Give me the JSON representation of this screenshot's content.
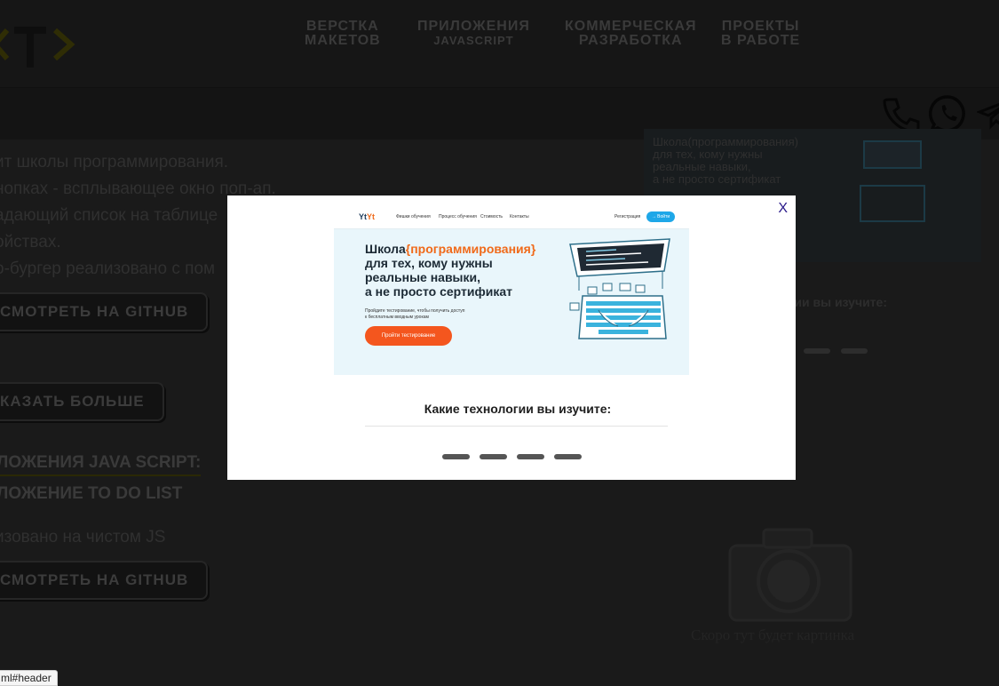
{
  "header": {
    "logo": "<T>",
    "nav": [
      {
        "line1": "ВЕРСТКА",
        "line2": "МАКЕТОВ"
      },
      {
        "line1": "ПРИЛОЖЕНИЯ",
        "line2": "JAVASCRIPT"
      },
      {
        "line1": "КОММЕРЧЕСКАЯ",
        "line2": "РАЗРАБОТКА"
      },
      {
        "line1": "ПРОЕКТЫ",
        "line2": "В РАБОТЕ"
      }
    ]
  },
  "contacts": {
    "icons": [
      "phone-icon",
      "whatsapp-icon",
      "telegram-icon"
    ]
  },
  "background": {
    "desc_lines": [
      "ит школы программирования.",
      "нопках - всплывающее окно поп-ап.",
      "адающий список на таблице",
      "ойствах.",
      "о-бургер реализовано с пом"
    ],
    "github_button_1": "СМОТРЕТЬ НА GITHUB",
    "show_more_button": "КАЗАТЬ БОЛЬШЕ",
    "section_title": "ЛОЖЕНИЯ JAVA SCRIPT:",
    "app_title": "ЛОЖЕНИЕ TO DO LIST",
    "app_desc": "изовано на чистом JS",
    "github_button_2": "СМОТРЕТЬ НА GITHUB",
    "right_preview_text": [
      "Школа(программирования)",
      "для тех, кому нужны",
      "реальные навыки,",
      "а не просто сертификат"
    ],
    "right_subtitle": "огии вы изучите:",
    "soon_text": "Скоро тут будет картинка"
  },
  "modal": {
    "close_label": "X",
    "screenshot": {
      "logo_a": "Yt",
      "logo_b": "Yt",
      "nav_links": [
        "Фишки обучения",
        "Процесс обучения",
        "Стоимость",
        "Контакты"
      ],
      "login": "Регистрация",
      "enter_button": "→ Войти",
      "headline_pre": "Школа",
      "headline_accent": "{программирования}",
      "headline_lines": [
        "для тех, кому нужны",
        "реальные навыки,",
        "а не просто сертификат"
      ],
      "subtext": [
        "Пройдите тестирование, чтобы получить доступ",
        "к бесплатным вводным урокам"
      ],
      "cta_button": "Пройти тестирование"
    },
    "tech_title": "Какие технологии вы изучите:"
  },
  "status_bar": {
    "url": "ml#header"
  },
  "colors": {
    "accent_yellow": "#ece11a",
    "orange": "#f4561e",
    "blue": "#1ea7e8",
    "close_purple": "#2a1a8a"
  }
}
